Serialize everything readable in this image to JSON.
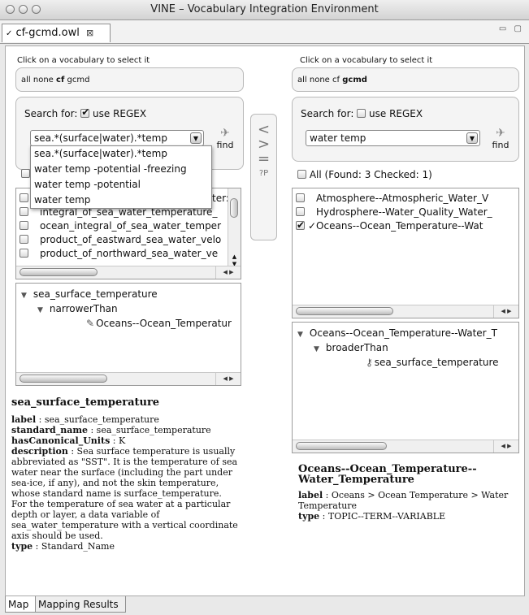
{
  "window": {
    "title": "VINE – Vocabulary Integration Environment"
  },
  "editor_tab": {
    "label": "cf-gcmd.owl",
    "close": "⊠"
  },
  "window_controls": "▭ ▢",
  "left": {
    "vocab_prompt": "Click on a vocabulary to select it",
    "vocab_options": [
      "all",
      "none",
      "cf",
      "gcmd"
    ],
    "vocab_selected": "cf",
    "search_label": "Search for:",
    "regex_label": "use REGEX",
    "regex_checked": true,
    "search_value": "sea.*(surface|water).*temp",
    "find_label": "find",
    "dropdown": [
      "sea.*(surface|water).*temp",
      "water temp  -potential -freezing",
      "water temp  -potential",
      "water temp"
    ],
    "results": [
      "ter:",
      "integral_of_sea_water_temperature_",
      "ocean_integral_of_sea_water_temper",
      "product_of_eastward_sea_water_velo",
      "product_of_northward_sea_water_ve"
    ],
    "tree": {
      "root": "sea_surface_temperature",
      "relation": "narrowerThan",
      "leaf": "Oceans--Ocean_Temperatur"
    },
    "detail": {
      "title": "sea_surface_temperature",
      "fields": [
        {
          "key": "label",
          "value": "sea_surface_temperature"
        },
        {
          "key": "standard_name",
          "value": "sea_surface_temperature"
        },
        {
          "key": "hasCanonical_Units",
          "value": "K"
        },
        {
          "key": "description",
          "value": "Sea surface temperature is usually abbreviated as \"SST\". It is the temperature of sea water near the surface (including the part under sea-ice, if any), and not the skin temperature, whose standard name is surface_temperature. For the temperature of sea water at a particular depth or layer, a data variable of sea_water_temperature with a vertical coordinate axis should be used."
        },
        {
          "key": "type",
          "value": "Standard_Name"
        }
      ]
    }
  },
  "middle": {
    "buttons": [
      "<",
      ">",
      "=",
      "?P"
    ]
  },
  "right": {
    "vocab_prompt": "Click on a vocabulary to select it",
    "vocab_options": [
      "all",
      "none",
      "cf",
      "gcmd"
    ],
    "vocab_selected": "gcmd",
    "search_label": "Search for:",
    "regex_label": "use REGEX",
    "regex_checked": false,
    "search_value": "water temp",
    "find_label": "find",
    "all_label": "All",
    "found_status": "(Found: 3 Checked: 1)",
    "results": [
      {
        "label": "Atmosphere--Atmospheric_Water_V",
        "checked": false
      },
      {
        "label": "Hydrosphere--Water_Quality_Water_",
        "checked": false
      },
      {
        "label": "✓Oceans--Ocean_Temperature--Wat",
        "checked": true
      }
    ],
    "tree": {
      "root": "Oceans--Ocean_Temperature--Water_T",
      "relation": "broaderThan",
      "leaf": "sea_surface_temperature"
    },
    "detail": {
      "title": "Oceans--Ocean_Temperature--Water_Temperature",
      "fields": [
        {
          "key": "label",
          "value": "Oceans > Ocean Temperature > Water Temperature"
        },
        {
          "key": "type",
          "value": "TOPIC--TERM--VARIABLE"
        }
      ]
    }
  },
  "bottom_tabs": [
    "Map",
    "Mapping Results"
  ]
}
